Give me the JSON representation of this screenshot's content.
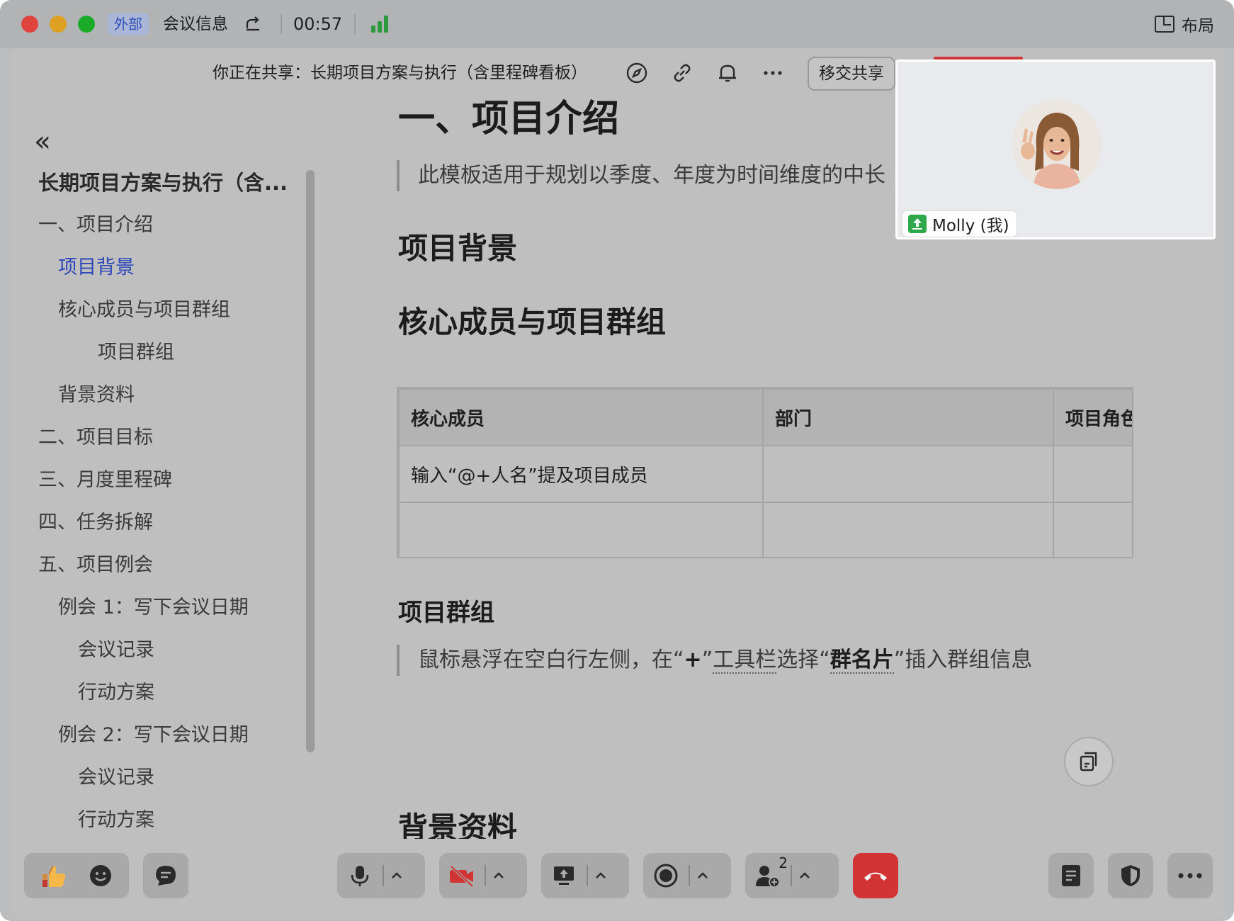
{
  "titlebar": {
    "external_badge": "外部",
    "meeting_info": "会议信息",
    "timer": "00:57",
    "layout_label": "布局"
  },
  "share_bar": {
    "text": "你正在共享：长期项目方案与执行（含里程碑看板）",
    "transfer_button": "移交共享"
  },
  "sidebar": {
    "doc_title": "长期项目方案与执行（含...",
    "items": [
      {
        "label": "一、项目介绍"
      },
      {
        "label": "项目背景"
      },
      {
        "label": "核心成员与项目群组"
      },
      {
        "label": "项目群组"
      },
      {
        "label": "背景资料"
      },
      {
        "label": "二、项目目标"
      },
      {
        "label": "三、月度里程碑"
      },
      {
        "label": "四、任务拆解"
      },
      {
        "label": "五、项目例会"
      },
      {
        "label": "例会 1：写下会议日期"
      },
      {
        "label": "会议记录"
      },
      {
        "label": "行动方案"
      },
      {
        "label": "例会 2：写下会议日期"
      },
      {
        "label": "会议记录"
      },
      {
        "label": "行动方案"
      }
    ]
  },
  "document": {
    "h1": "一、项目介绍",
    "intro_quote": "此模板适用于规划以季度、年度为时间维度的中长",
    "h_background": "项目背景",
    "h_members": "核心成员与项目群组",
    "table": {
      "headers": [
        "核心成员",
        "部门",
        "项目角色"
      ],
      "rows": [
        [
          "输入“@+人名”提及项目成员",
          "",
          ""
        ],
        [
          "",
          "",
          ""
        ]
      ]
    },
    "h_group": "项目群组",
    "group_quote": {
      "p1": "鼠标悬浮在空白行左侧，在“",
      "plus": "+",
      "p2": "”",
      "toolbar": "工具栏",
      "p3": "选择“",
      "card": "群名片",
      "p4": "”插入群组信息"
    },
    "h_materials": "背景资料"
  },
  "video": {
    "participant_name": "Molly (我)"
  },
  "toolbar": {
    "participants_count": "2"
  },
  "colors": {
    "active_link": "#2c47b8",
    "hangup": "#d23434",
    "signal": "#2f9a3d",
    "camera_off": "#d23434"
  }
}
